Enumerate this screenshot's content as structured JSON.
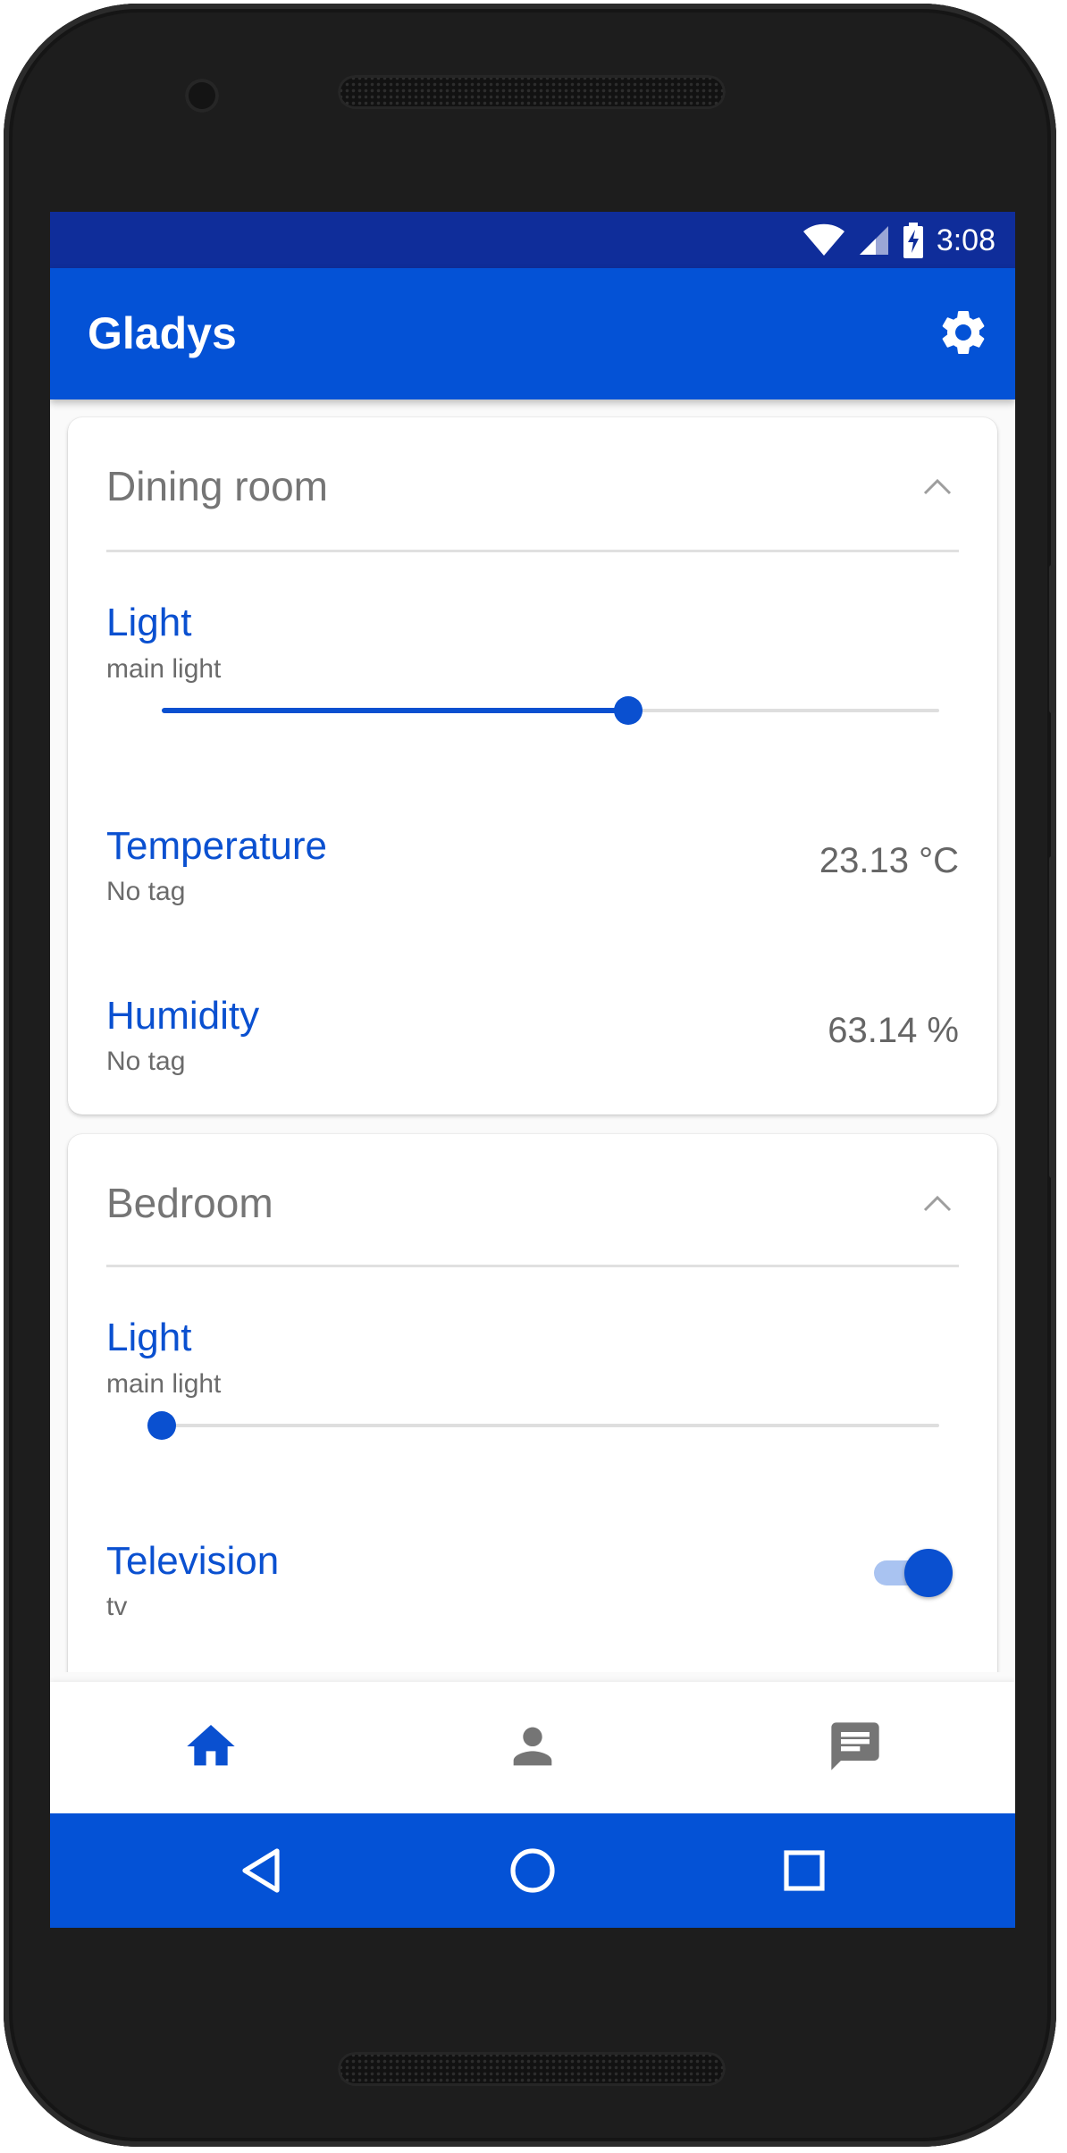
{
  "status_bar": {
    "time": "3:08",
    "icons": [
      "wifi-icon",
      "cell-signal-icon",
      "battery-charging-icon"
    ]
  },
  "app_bar": {
    "title": "Gladys",
    "settings_icon": "gear-icon"
  },
  "rooms": [
    {
      "name": "Dining room",
      "expanded": true,
      "devices": [
        {
          "name": "Light",
          "tag": "main light",
          "control": "slider",
          "level": 0.6
        },
        {
          "name": "Temperature",
          "tag": "No tag",
          "value": "23.13 °C"
        },
        {
          "name": "Humidity",
          "tag": "No tag",
          "value": "63.14 %"
        }
      ]
    },
    {
      "name": "Bedroom",
      "expanded": true,
      "devices": [
        {
          "name": "Light",
          "tag": "main light",
          "control": "slider",
          "level": 0.0
        },
        {
          "name": "Television",
          "tag": "tv",
          "control": "toggle",
          "on": true
        }
      ]
    }
  ],
  "bottom_nav": {
    "items": [
      {
        "icon": "home-icon",
        "active": true
      },
      {
        "icon": "person-icon",
        "active": false
      },
      {
        "icon": "message-icon",
        "active": false
      }
    ]
  },
  "system_nav": [
    "back-icon",
    "home-circle-icon",
    "recents-icon"
  ],
  "colors": {
    "primary": "#0452d6",
    "status_bar": "#0f2d9a",
    "accent_text": "#0a50d0",
    "inactive_icon": "#757575"
  }
}
